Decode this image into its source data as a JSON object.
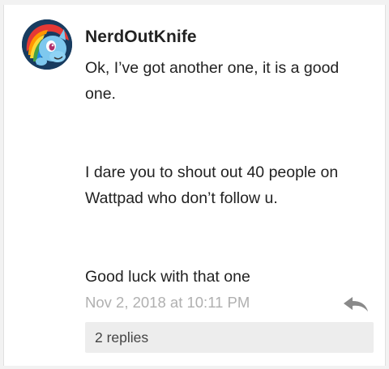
{
  "comment": {
    "author": "NerdOutKnife",
    "avatar_icon": "pony-avatar-icon",
    "paragraphs": [
      "Ok, I’ve got another one, it is a good one.",
      "I dare you to shout out 40 people on Wattpad who don’t follow u.",
      "Good luck with that one"
    ],
    "timestamp": "Nov 2, 2018 at 10:11 PM",
    "reply_icon": "reply-arrow-icon",
    "replies_label": "2 replies"
  },
  "colors": {
    "background": "#f2f2f2",
    "card": "#ffffff",
    "text": "#222222",
    "timestamp": "#b0b0b0",
    "replies_bar": "#ededed",
    "reply_icon": "#8a8a8a"
  }
}
